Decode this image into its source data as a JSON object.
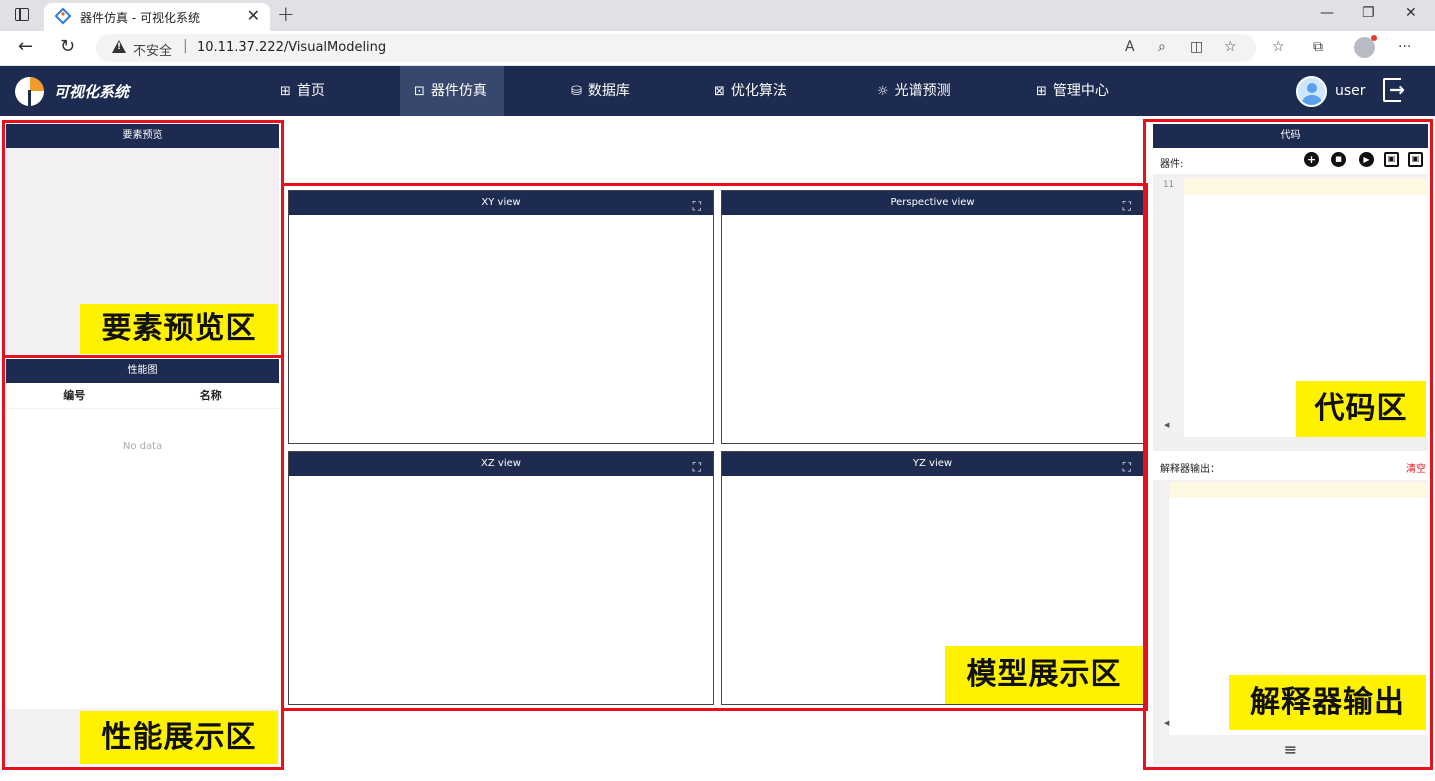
{
  "browser": {
    "tab_title": "器件仿真 - 可视化系统",
    "close_symbol": "✕",
    "new_tab_symbol": "+",
    "security_label": "不安全",
    "url": "10.11.37.222/VisualModeling",
    "window_controls": {
      "minimize": "—",
      "restore": "❐",
      "close": "✕"
    },
    "nav": {
      "back": "←",
      "reload": "↻"
    },
    "toolbar": {
      "read_aloud": "A",
      "zoom": "⌕",
      "split": "◫",
      "favorite_add": "☆",
      "favorites": "☆",
      "collections": "⧉",
      "more": "···"
    }
  },
  "app": {
    "brand": "可视化系统",
    "menu": [
      {
        "label": "首页",
        "icon": "⊞"
      },
      {
        "label": "器件仿真",
        "icon": "⊡"
      },
      {
        "label": "数据库",
        "icon": "⛁"
      },
      {
        "label": "优化算法",
        "icon": "⊠"
      },
      {
        "label": "光谱预测",
        "icon": "☼"
      },
      {
        "label": "管理中心",
        "icon": "⊞"
      }
    ],
    "active_menu": "器件仿真",
    "user": "user"
  },
  "left": {
    "preview_title": "要素预览",
    "perf_title": "性能图",
    "perf_columns": [
      "编号",
      "名称"
    ],
    "perf_empty": "No data"
  },
  "views": [
    {
      "title": "XY view",
      "expand": "⛶"
    },
    {
      "title": "Perspective view",
      "expand": "⛶"
    },
    {
      "title": "XZ view",
      "expand": "⛶"
    },
    {
      "title": "YZ view",
      "expand": "⛶"
    }
  ],
  "right": {
    "code_title": "代码",
    "device_label": "器件:",
    "tools": {
      "add": "+",
      "stop": "■",
      "run": "▶",
      "save": "▣",
      "save_as": "▣"
    },
    "line_number": "11",
    "interpreter_label": "解释器输出：",
    "clear": "清空",
    "footer_icon": "≡",
    "scroll_left": "◀"
  },
  "annotations": {
    "preview": "要素预览区",
    "perf": "性能展示区",
    "model": "模型展示区",
    "code": "代码区",
    "output": "解释器输出"
  },
  "colors": {
    "nav_bg": "#1e2b50",
    "accent_red": "#e8101c",
    "annotation_yellow": "#fff200",
    "logo_orange": "#f29b2c"
  }
}
